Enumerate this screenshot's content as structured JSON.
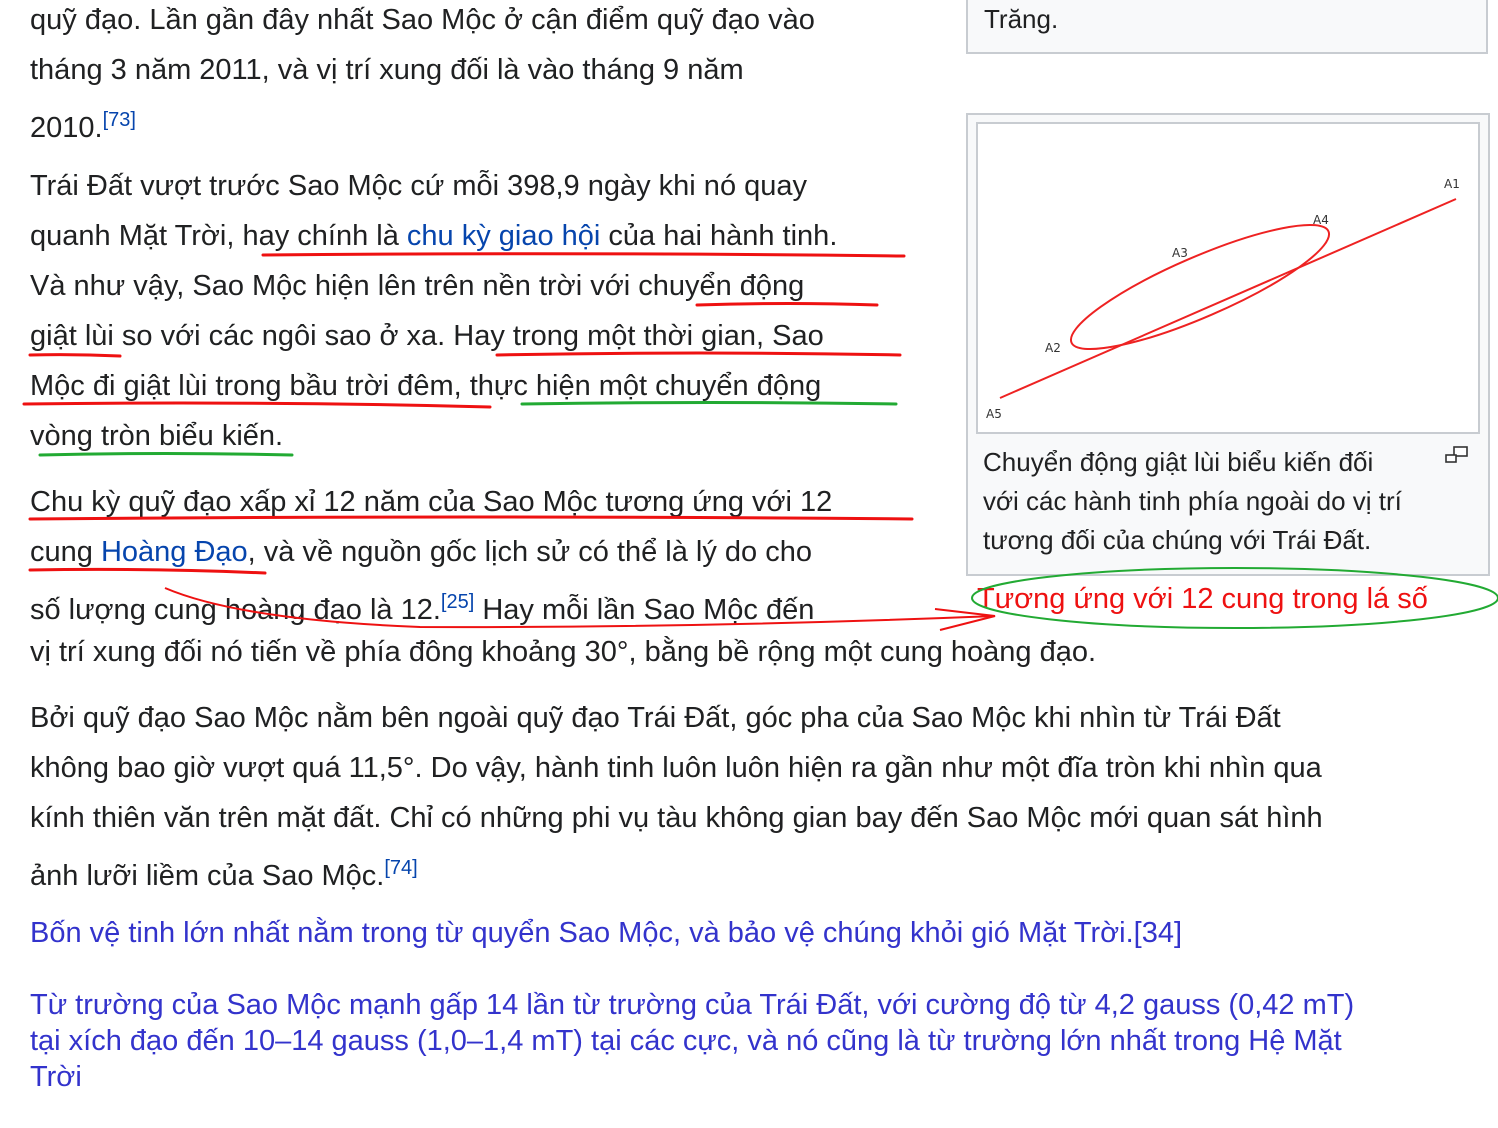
{
  "para1": {
    "l1": "quỹ đạo. Lần gần đây nhất Sao Mộc ở cận điểm quỹ đạo vào",
    "l2": "tháng 3 năm 2011, và vị trí xung đối là vào tháng 9 năm",
    "l3": "2010.",
    "ref": "[73]"
  },
  "para2": {
    "l1": "Trái Đất vượt trước Sao Mộc cứ mỗi 398,9 ngày khi nó quay",
    "l2a": "quanh Mặt Trời, hay chính là ",
    "l2link": "chu kỳ giao hội",
    "l2b": " của hai hành tinh.",
    "l3": "Và như vậy, Sao Mộc hiện lên trên nền trời với chuyển động",
    "l4": "giật lùi so với các ngôi sao ở xa. Hay trong một thời gian, Sao",
    "l5": "Mộc đi giật lùi trong bầu trời đêm, thực hiện một chuyển động",
    "l6": "vòng tròn biểu kiến."
  },
  "para3": {
    "l1": "Chu kỳ quỹ đạo xấp xỉ 12 năm của Sao Mộc tương ứng với 12",
    "l2a": "cung ",
    "l2link": "Hoàng Đạo",
    "l2b": ", và về nguồn gốc lịch sử có thể là lý do cho",
    "l3a": "số lượng cung hoàng đạo là 12.",
    "l3ref": "[25]",
    "l3b": " Hay mỗi lần Sao Mộc đến",
    "l4": "vị trí xung đối nó tiến về phía đông khoảng 30°, bằng bề rộng một cung hoàng đạo."
  },
  "para4": {
    "l1": "Bởi quỹ đạo Sao Mộc nằm bên ngoài quỹ đạo Trái Đất, góc pha của Sao Mộc khi nhìn từ Trái Đất",
    "l2": "không bao giờ vượt quá 11,5°. Do vậy, hành tinh luôn luôn hiện ra gần như một đĩa tròn khi nhìn qua",
    "l3": "kính thiên văn trên mặt đất. Chỉ có những phi vụ tàu không gian bay đến Sao Mộc mới quan sát hình",
    "l4": "ảnh lưỡi liềm của Sao Mộc.",
    "ref": "[74]"
  },
  "blue1": "Bốn vệ tinh lớn nhất nằm trong từ quyển Sao Mộc, và bảo vệ chúng khỏi gió Mặt Trời.[34]",
  "blue2": {
    "l1": "Từ trường của Sao Mộc mạnh gấp 14 lần từ trường của Trái Đất, với cường độ từ 4,2 gauss (0,42 mT)",
    "l2": "tại xích đạo đến 10–14 gauss (1,0–1,4 mT) tại các cực, và nó cũng là từ trường lớn nhất trong Hệ Mặt",
    "l3": "Trời"
  },
  "thumb_top": "Trăng.",
  "figure": {
    "labels": {
      "a1": "A1",
      "a2": "A2",
      "a3": "A3",
      "a4": "A4",
      "a5": "A5"
    },
    "caption": {
      "l1": "Chuyển động giật lùi biểu kiến đối",
      "l2": "với các hành tinh phía ngoài do vị trí",
      "l3": "tương đối của chúng với Trái Đất."
    },
    "enlarge_icon": "enlarge-icon"
  },
  "annotation": "Tương ứng với 12 cung trong lá số",
  "colors": {
    "link": "#0645ad",
    "red": "#ee1111",
    "green": "#22aa33",
    "blue_text": "#3333cc"
  }
}
